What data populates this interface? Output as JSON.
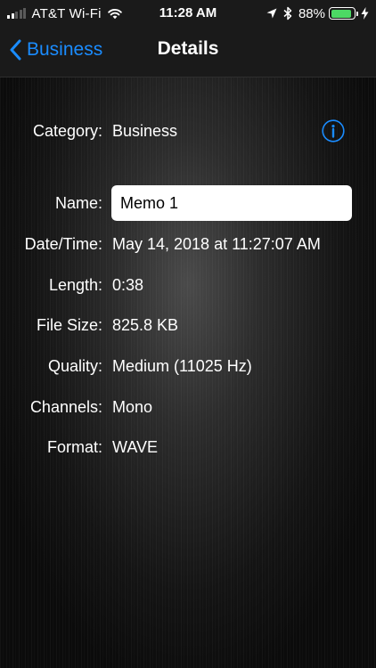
{
  "status_bar": {
    "carrier": "AT&T Wi-Fi",
    "time": "11:28 AM",
    "battery_percent": "88%",
    "battery_level": 0.88,
    "signal_bars_total": 5,
    "signal_bars_filled": 2
  },
  "nav": {
    "back_label": "Business",
    "title": "Details"
  },
  "details": {
    "category": {
      "label": "Category:",
      "value": "Business"
    },
    "name": {
      "label": "Name:",
      "value": "Memo 1"
    },
    "date_time": {
      "label": "Date/Time:",
      "value": "May 14, 2018 at 11:27:07 AM"
    },
    "length": {
      "label": "Length:",
      "value": "0:38"
    },
    "file_size": {
      "label": "File Size:",
      "value": "825.8 KB"
    },
    "quality": {
      "label": "Quality:",
      "value": "Medium (11025 Hz)"
    },
    "channels": {
      "label": "Channels:",
      "value": "Mono"
    },
    "format": {
      "label": "Format:",
      "value": "WAVE"
    }
  },
  "icons": {
    "back": "chevron-left-icon",
    "info": "info-circle-icon",
    "wifi": "wifi-icon",
    "location": "location-arrow-icon",
    "bluetooth": "bluetooth-icon",
    "charging": "charging-bolt-icon"
  },
  "colors": {
    "accent": "#1a8cff",
    "battery": "#4cd964",
    "background": "#000000"
  }
}
